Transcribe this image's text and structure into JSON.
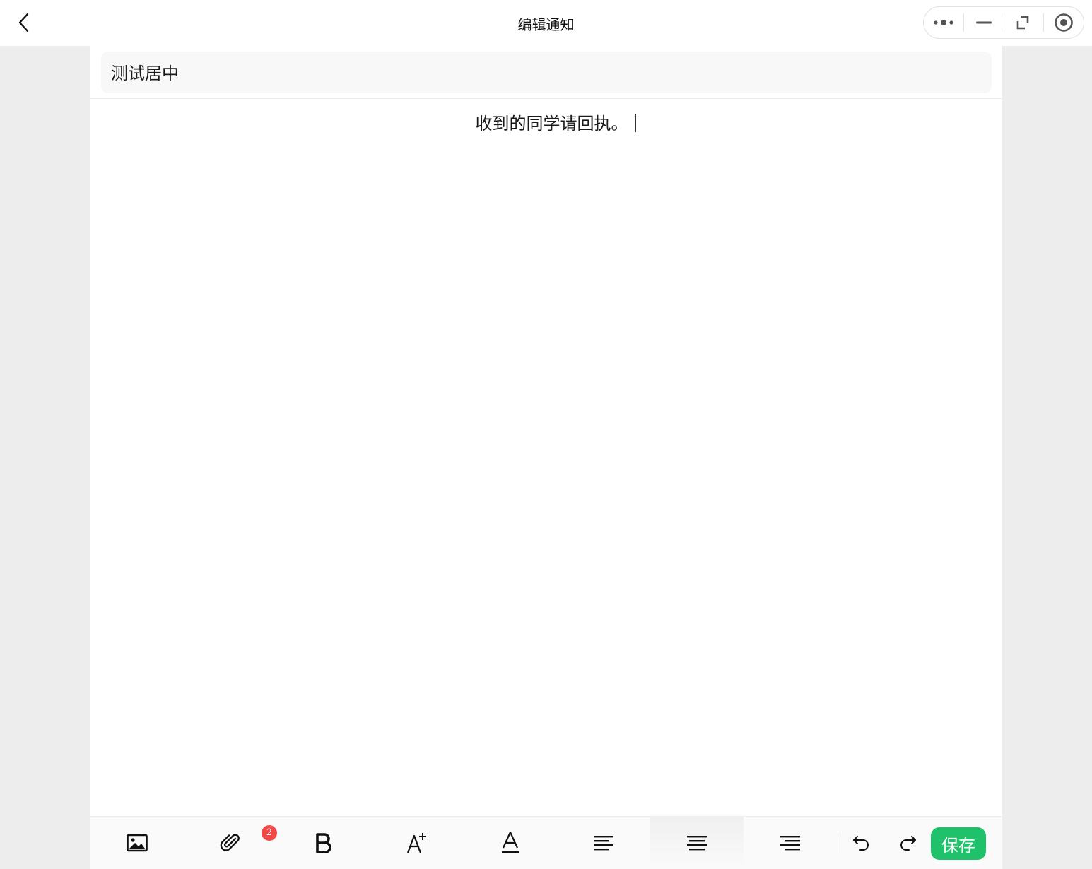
{
  "navbar": {
    "title": "编辑通知",
    "back_icon": "chevron-left-icon",
    "capsule": [
      "more-icon",
      "minimize-icon",
      "resize-icon",
      "record-icon"
    ]
  },
  "notice": {
    "title_value": "测试居中",
    "body_text": "收到的同学请回执。"
  },
  "toolbar": {
    "tools": [
      "image-icon",
      "paperclip-icon",
      "bold-icon",
      "font-size-increase-icon",
      "font-color-icon",
      "align-left-icon",
      "align-center-icon",
      "align-right-icon",
      "undo-icon",
      "redo-icon"
    ],
    "active_tool": "align-center",
    "attachment_count": "2",
    "save_label": "保存",
    "save_color": "#1fc16b",
    "badge_color": "#f04747"
  }
}
